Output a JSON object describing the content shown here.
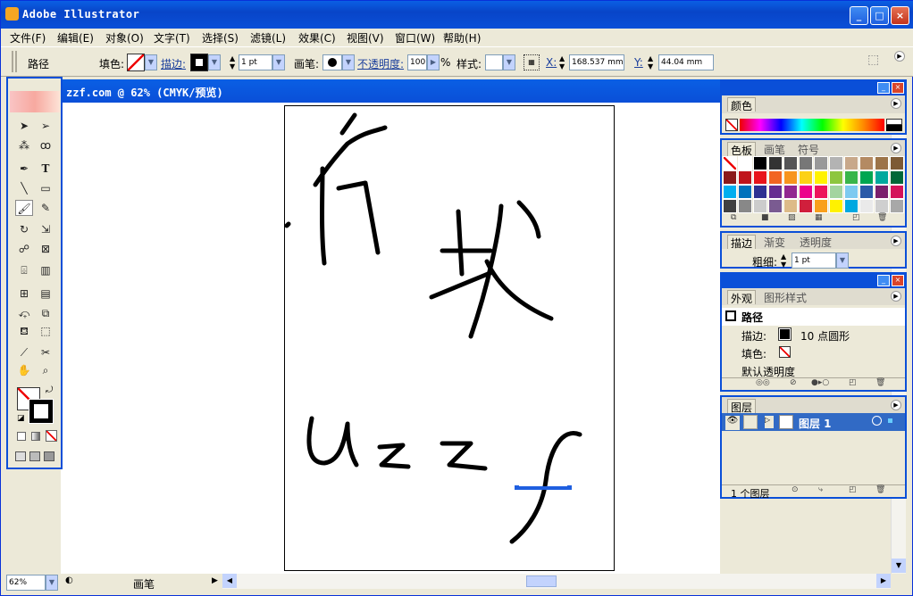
{
  "app": {
    "title": "Adobe Illustrator"
  },
  "menu": [
    "文件(F)",
    "编辑(E)",
    "对象(O)",
    "文字(T)",
    "选择(S)",
    "滤镜(L)",
    "效果(C)",
    "视图(V)",
    "窗口(W)",
    "帮助(H)"
  ],
  "control": {
    "path_label": "路径",
    "fill_label": "填色:",
    "stroke_label": "描边:",
    "stroke_weight": "1 pt",
    "brush_label": "画笔:",
    "opacity_label": "不透明度:",
    "opacity_value": "100",
    "opacity_unit": "%",
    "style_label": "样式:",
    "x_label": "X:",
    "x_value": "168.537 mm",
    "y_label": "Y:",
    "y_value": "44.04 mm"
  },
  "document": {
    "title": "zzf.com @ 62% (CMYK/预览)"
  },
  "status": {
    "zoom": "62%",
    "tool": "画笔"
  },
  "artwork": {
    "line1": "东",
    "line2": "坡",
    "line3": "uzzf"
  },
  "panels": {
    "color": {
      "tab": "颜色"
    },
    "swatches": {
      "tabs": [
        "色板",
        "画笔",
        "符号"
      ]
    },
    "stroke": {
      "tabs": [
        "描边",
        "渐变",
        "透明度"
      ],
      "weight_label": "粗细:",
      "weight_value": "1 pt"
    },
    "appearance": {
      "tabs": [
        "外观",
        "图形样式"
      ],
      "object": "路径",
      "stroke_label": "描边:",
      "stroke_value": "10 点圆形",
      "fill_label": "填色:",
      "opacity": "默认透明度"
    },
    "layers": {
      "tab": "图层",
      "layer_name": "图层 1",
      "count": "1 个图层"
    }
  },
  "colors": {
    "titlebar": "#0a4fd8",
    "swatch_rows": [
      [
        "#ffffff",
        "#ffffff",
        "#000000",
        "#333333",
        "#555555",
        "#777777",
        "#999999",
        "#b3b3b3",
        "#c8a88a",
        "#b48a62",
        "#9c7448",
        "#7d5a35"
      ],
      [
        "#8b1a1a",
        "#c0141b",
        "#e8141b",
        "#f26522",
        "#f7941d",
        "#fcd116",
        "#fff200",
        "#8dc63f",
        "#39b54a",
        "#00a651",
        "#00a99d",
        "#006838"
      ],
      [
        "#00aeef",
        "#0072bc",
        "#2e3192",
        "#662d91",
        "#92278f",
        "#ec008c",
        "#ed145b",
        "#a3d4a0",
        "#7dcaf0",
        "#2a5aa8",
        "#7a1f6b",
        "#d4145a"
      ],
      [
        "#404040",
        "#888888",
        "#cccccc",
        "#7a5b91",
        "#ddbb88",
        "#d01f3c",
        "#f9a01b",
        "#fff200",
        "#00a9e0",
        "#eaeaea",
        "#cfcfcf",
        "#a8a8a8"
      ]
    ]
  }
}
